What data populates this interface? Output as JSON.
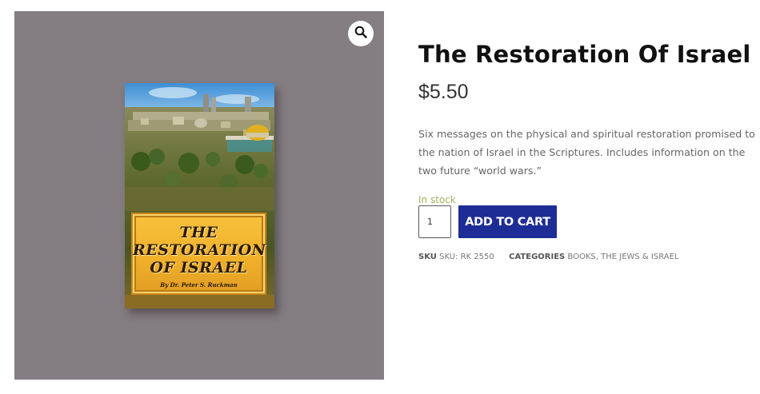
{
  "gallery": {
    "zoom_icon": "magnifier-icon",
    "background": "#847d82",
    "book_cover": {
      "title_line1": "THE",
      "title_line2": "RESTORATION",
      "title_line3": "OF ISRAEL",
      "author": "By Dr. Peter S. Ruckman"
    }
  },
  "product": {
    "title": "The Restoration Of Israel",
    "price": "$5.50",
    "description": "Six messages on the physical and spiritual restoration promised to the nation of Israel in the Scriptures. Includes information on the two future “world wars.”",
    "stock_status": "In stock",
    "quantity": "1",
    "add_to_cart_label": "ADD TO CART",
    "sku_label": "SKU",
    "sku_value": "SKU: RK 2550",
    "categories_label": "CATEGORIES",
    "categories": [
      "BOOKS",
      "THE JEWS & ISRAEL"
    ],
    "category_separator": ", "
  },
  "colors": {
    "accent_button": "#1e2d96",
    "stock_text": "#a4b15a",
    "title_text": "#111111"
  }
}
